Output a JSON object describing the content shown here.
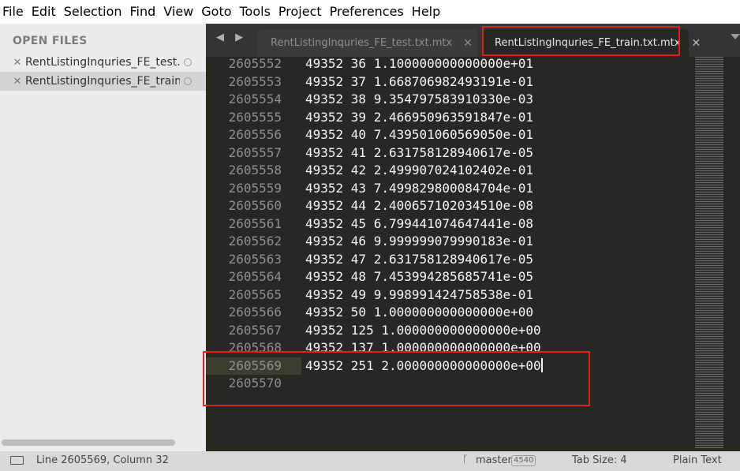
{
  "menu": [
    "File",
    "Edit",
    "Selection",
    "Find",
    "View",
    "Goto",
    "Tools",
    "Project",
    "Preferences",
    "Help"
  ],
  "sidebar": {
    "header": "OPEN FILES",
    "files": [
      {
        "name": "RentListingInquries_FE_test.txt.mtx",
        "active": false
      },
      {
        "name": "RentListingInquries_FE_train.txt.mtx",
        "active": true
      }
    ]
  },
  "tabs": {
    "arrows": "◀ ▶",
    "items": [
      {
        "label": "RentListingInquries_FE_test.txt.mtx",
        "close": "✕",
        "active": false
      },
      {
        "label": "RentListingInquries_FE_train.txt.mtx",
        "close": "✕",
        "active": true
      }
    ]
  },
  "editor": {
    "lines": [
      {
        "num": "2605552",
        "text": "49352 36 1.100000000000000e+01"
      },
      {
        "num": "2605553",
        "text": "49352 37 1.668706982493191e-01"
      },
      {
        "num": "2605554",
        "text": "49352 38 9.354797583910330e-03"
      },
      {
        "num": "2605555",
        "text": "49352 39 2.466950963591847e-01"
      },
      {
        "num": "2605556",
        "text": "49352 40 7.439501060569050e-01"
      },
      {
        "num": "2605557",
        "text": "49352 41 2.631758128940617e-05"
      },
      {
        "num": "2605558",
        "text": "49352 42 2.499907024102402e-01"
      },
      {
        "num": "2605559",
        "text": "49352 43 7.499829800084704e-01"
      },
      {
        "num": "2605560",
        "text": "49352 44 2.400657102034510e-08"
      },
      {
        "num": "2605561",
        "text": "49352 45 6.799441074647441e-08"
      },
      {
        "num": "2605562",
        "text": "49352 46 9.999999079990183e-01"
      },
      {
        "num": "2605563",
        "text": "49352 47 2.631758128940617e-05"
      },
      {
        "num": "2605564",
        "text": "49352 48 7.453994285685741e-05"
      },
      {
        "num": "2605565",
        "text": "49352 49 9.998991424758538e-01"
      },
      {
        "num": "2605566",
        "text": "49352 50 1.000000000000000e+00"
      },
      {
        "num": "2605567",
        "text": "49352 125 1.000000000000000e+00"
      },
      {
        "num": "2605568",
        "text": "49352 137 1.000000000000000e+00"
      },
      {
        "num": "2605569",
        "text": "49352 251 2.000000000000000e+00"
      },
      {
        "num": "2605570",
        "text": ""
      }
    ],
    "current_line_index": 17
  },
  "status": {
    "position": "Line 2605569, Column 32",
    "branch_icon": "ᚴ",
    "branch": "master",
    "branch_count": "4540",
    "tab_size": "Tab Size: 4",
    "syntax": "Plain Text"
  },
  "colors": {
    "editor_bg": "#272822",
    "annotation_red": "#e02020"
  }
}
